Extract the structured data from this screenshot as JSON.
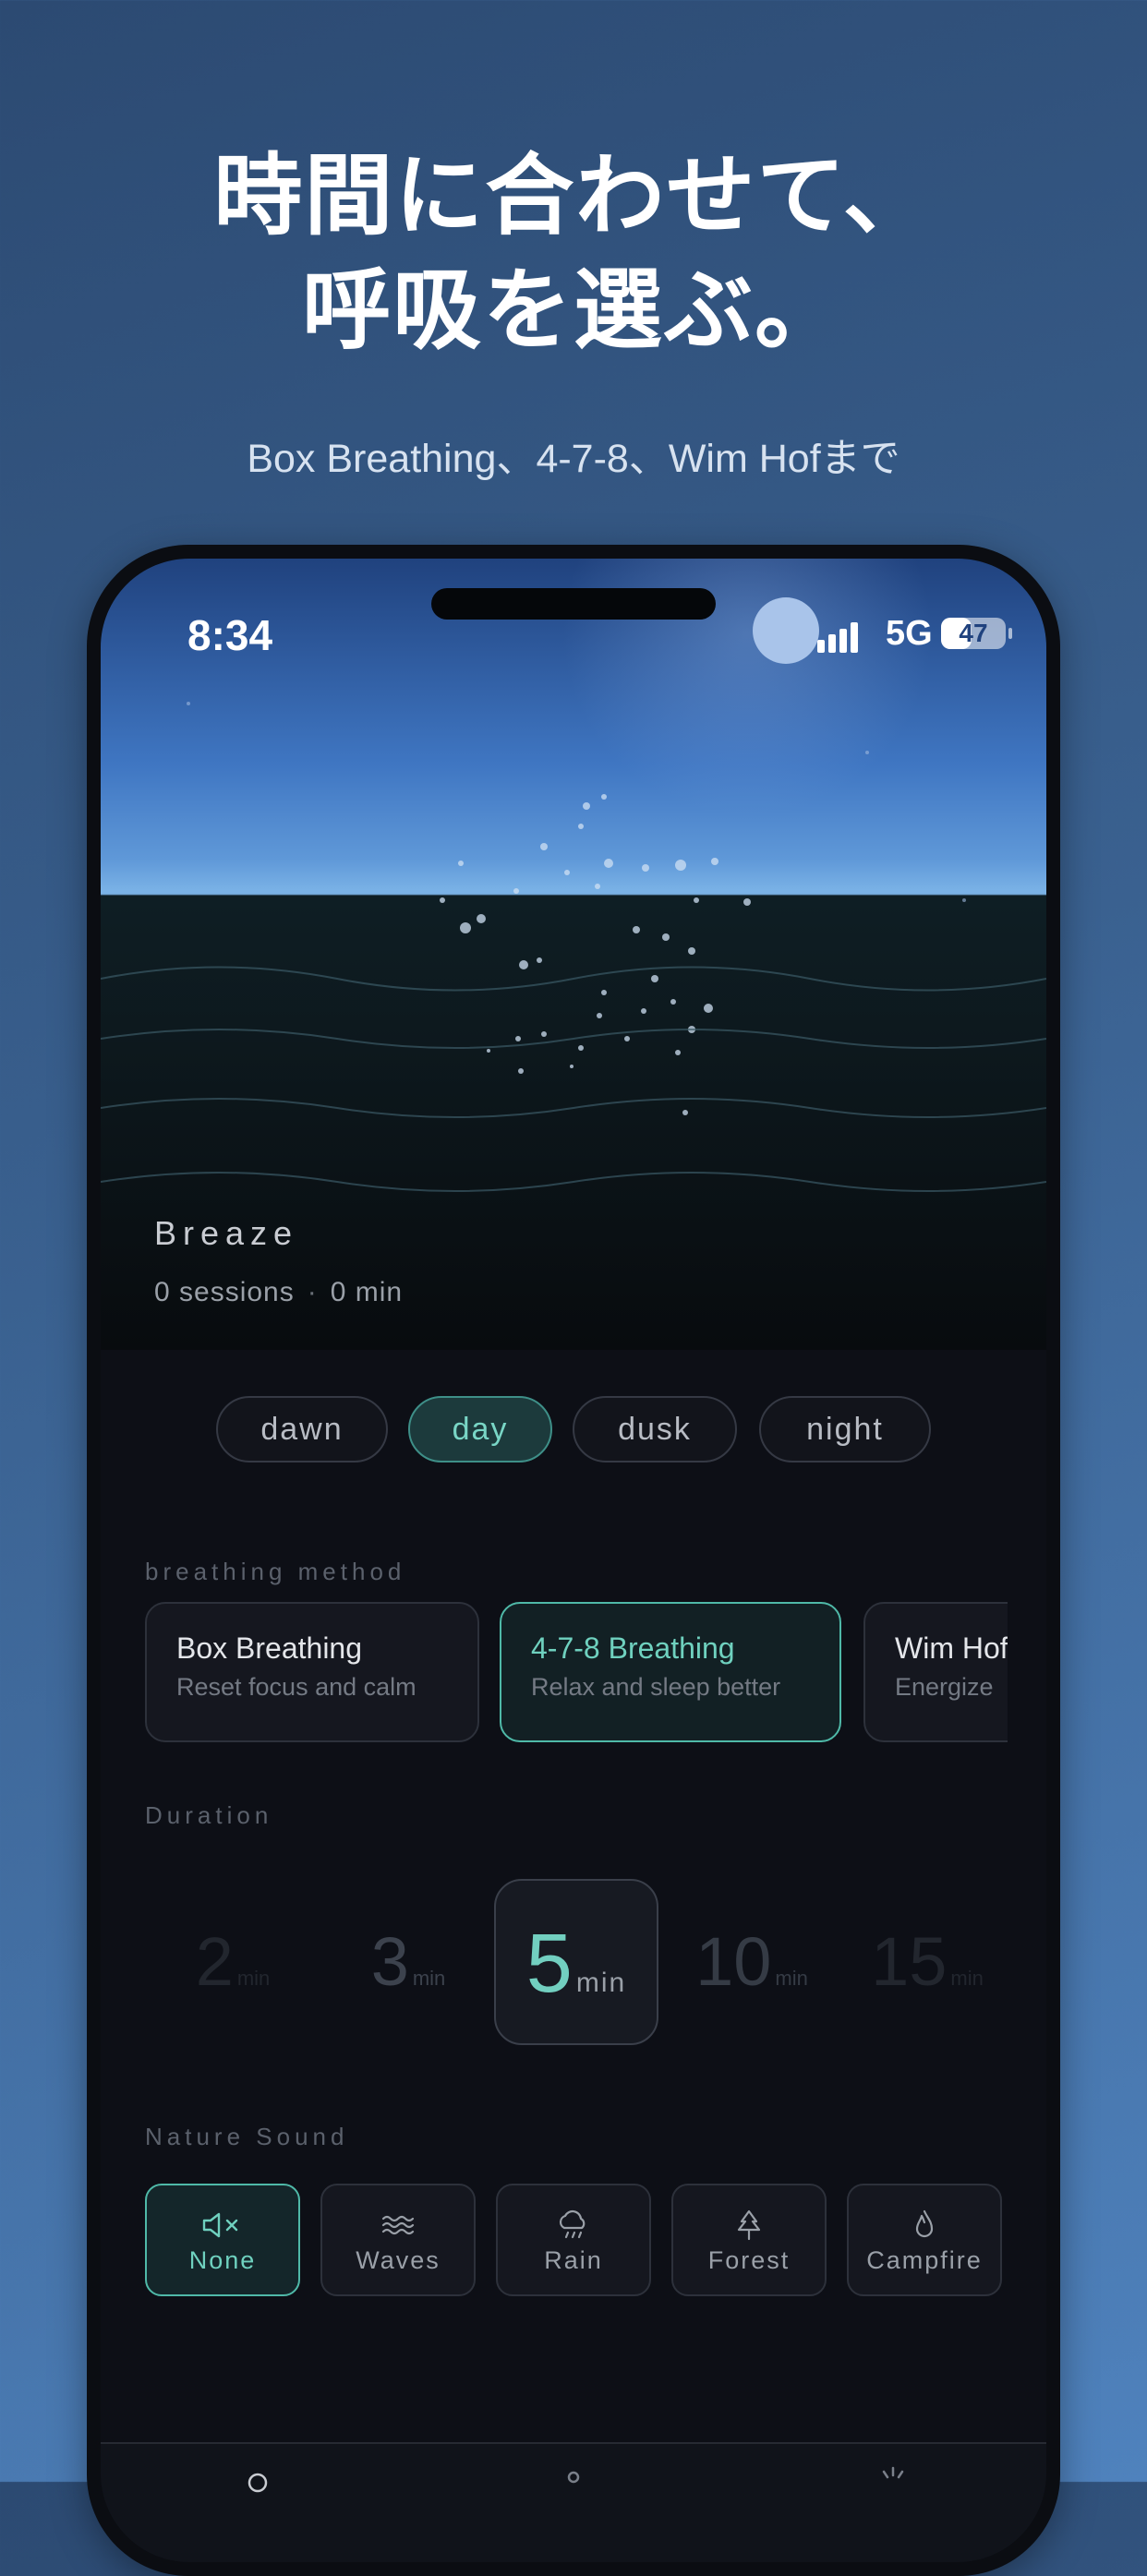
{
  "promo": {
    "title_line1": "時間に合わせて、",
    "title_line2": "呼吸を選ぶ。",
    "subtitle": "Box Breathing、4-7-8、Wim Hofまで"
  },
  "status_bar": {
    "time": "8:34",
    "network": "5G",
    "battery": "47",
    "battery_level": 0.47
  },
  "hero": {
    "app_name": "Breaze",
    "sessions": "0 sessions",
    "separator": "·",
    "minutes": "0 min"
  },
  "time_of_day": {
    "selected": "day",
    "options": [
      "dawn",
      "day",
      "dusk",
      "night"
    ]
  },
  "breathing": {
    "label": "breathing method",
    "methods": [
      {
        "title": "Box Breathing",
        "subtitle": "Reset focus and calm",
        "selected": false
      },
      {
        "title": "4-7-8 Breathing",
        "subtitle": "Relax and sleep better",
        "selected": true
      },
      {
        "title": "Wim Hof",
        "subtitle": "Energize",
        "selected": false
      }
    ]
  },
  "duration": {
    "label": "Duration",
    "unit": "min",
    "options": [
      "2",
      "3",
      "5",
      "10",
      "15",
      "2"
    ],
    "selected": "5"
  },
  "nature_sound": {
    "label": "Nature Sound",
    "options": [
      {
        "label": "None",
        "icon": "speaker-mute-icon",
        "selected": true
      },
      {
        "label": "Waves",
        "icon": "waves-icon",
        "selected": false
      },
      {
        "label": "Rain",
        "icon": "rain-icon",
        "selected": false
      },
      {
        "label": "Forest",
        "icon": "tree-icon",
        "selected": false
      },
      {
        "label": "Campfire",
        "icon": "flame-icon",
        "selected": false
      }
    ]
  },
  "colors": {
    "accent": "#6fd1bf",
    "background": "#0d0f16"
  }
}
